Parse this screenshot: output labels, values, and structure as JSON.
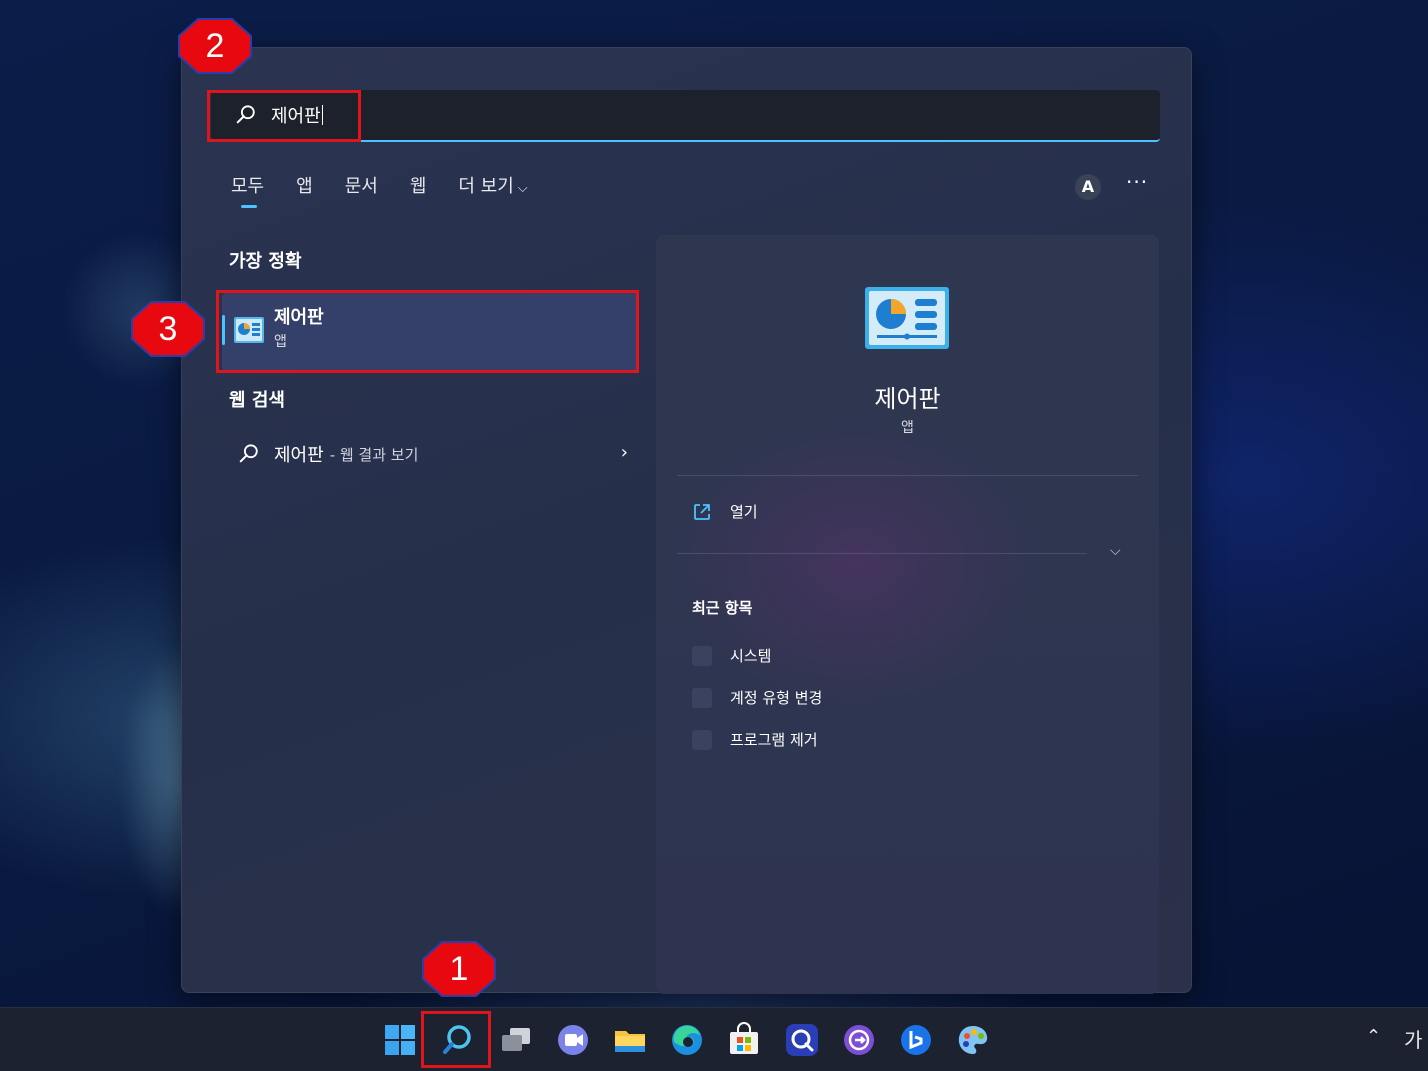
{
  "search": {
    "query": "제어판"
  },
  "tabs": [
    {
      "label": "모두"
    },
    {
      "label": "앱"
    },
    {
      "label": "문서"
    },
    {
      "label": "웹"
    },
    {
      "label": "더 보기"
    }
  ],
  "account_initial": "A",
  "more_label": "···",
  "best_match": {
    "heading": "가장 정확",
    "title": "제어판",
    "subtitle": "앱"
  },
  "web_search": {
    "heading": "웹 검색",
    "query": "제어판",
    "suffix": "- 웹 결과 보기"
  },
  "preview": {
    "title": "제어판",
    "subtitle": "앱",
    "open_label": "열기",
    "recent_heading": "최근 항목",
    "recent_items": [
      "시스템",
      "계정 유형 변경",
      "프로그램 제거"
    ]
  },
  "tray": {
    "ime": "가"
  },
  "annotations": {
    "badge1": "1",
    "badge2": "2",
    "badge3": "3"
  },
  "colors": {
    "accent": "#4cc2ff",
    "highlight": "#e0151c",
    "badge_fill": "#e8080f"
  },
  "icons": {
    "search": "search-icon",
    "control_panel": "control-panel-icon",
    "open": "open-external-icon"
  }
}
